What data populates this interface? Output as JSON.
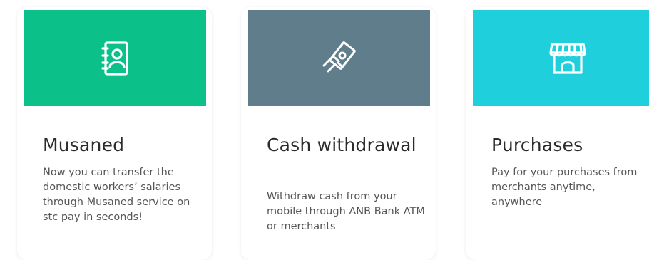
{
  "colors": {
    "green": "#0cc08a",
    "slate": "#607d8b",
    "cyan": "#1fcfdb"
  },
  "cards": [
    {
      "title": "Musaned",
      "description": "Now you can transfer the domestic workers’ salaries through Musaned service on stc pay in seconds!",
      "icon": "contact-book-icon"
    },
    {
      "title": "Cash withdrawal",
      "description": "Withdraw cash from your mobile through ANB Bank ATM or merchants",
      "icon": "hand-cash-icon"
    },
    {
      "title": "Purchases",
      "description": "Pay for your purchases from merchants anytime, anywhere",
      "icon": "storefront-icon"
    }
  ]
}
